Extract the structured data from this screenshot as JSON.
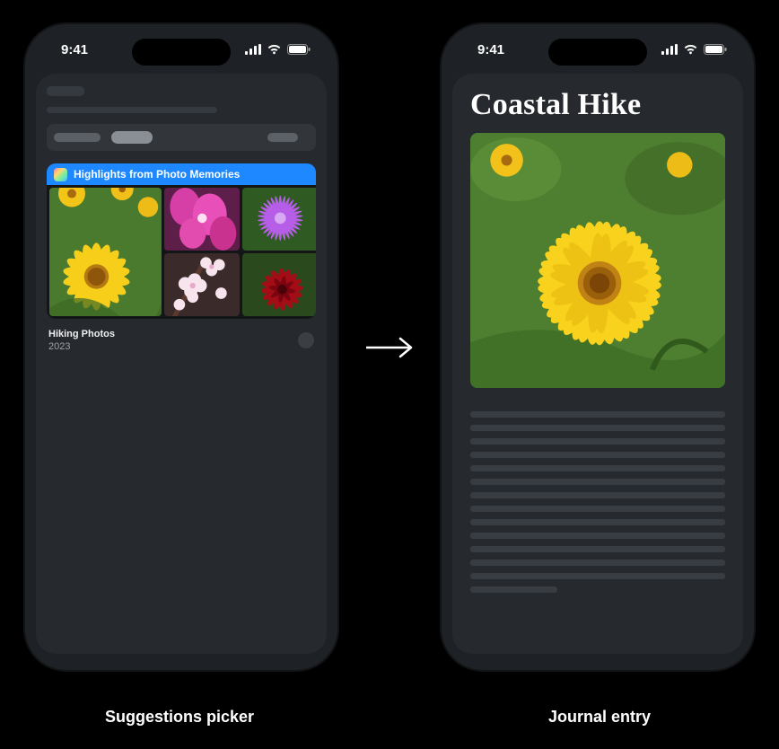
{
  "status": {
    "time": "9:41"
  },
  "picker": {
    "highlights_label": "Highlights from Photo Memories",
    "card_title": "Hiking Photos",
    "card_year": "2023"
  },
  "entry": {
    "title": "Coastal Hike"
  },
  "captions": {
    "left": "Suggestions picker",
    "right": "Journal entry"
  }
}
